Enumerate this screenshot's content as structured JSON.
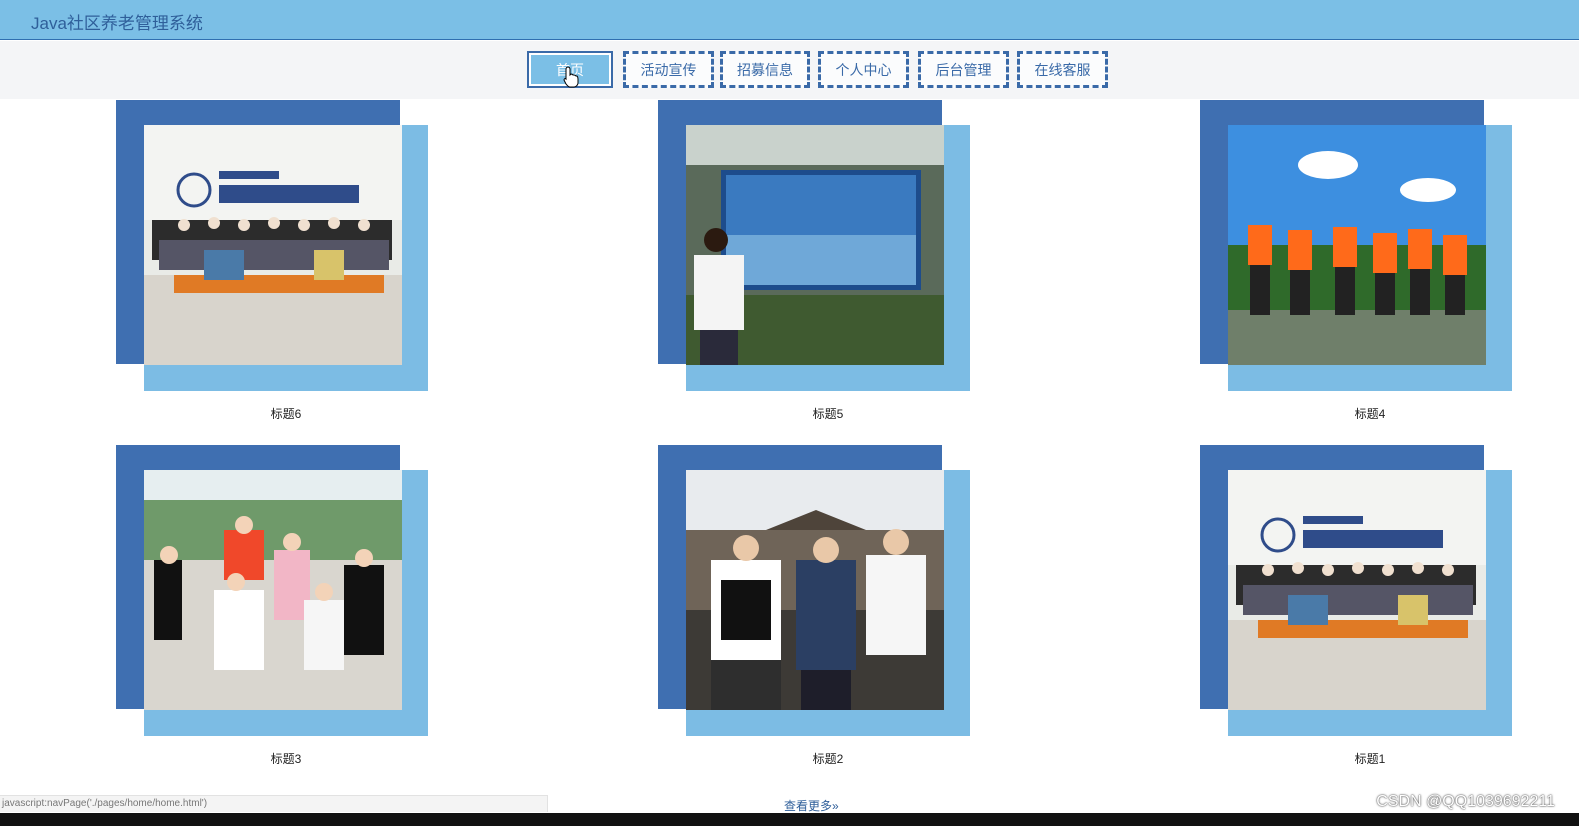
{
  "app": {
    "title": "Java社区养老管理系统"
  },
  "nav": {
    "items": [
      {
        "label": "首页",
        "active": true
      },
      {
        "label": "活动宣传"
      },
      {
        "label": "招募信息"
      },
      {
        "label": "个人中心"
      },
      {
        "label": "后台管理"
      },
      {
        "label": "在线客服"
      }
    ]
  },
  "gallery": {
    "items": [
      {
        "caption": "标题6",
        "photo": "group-photo-institute"
      },
      {
        "caption": "标题5",
        "photo": "person-with-screen"
      },
      {
        "caption": "标题4",
        "photo": "group-life-vests"
      },
      {
        "caption": "标题3",
        "photo": "group-mountain-view"
      },
      {
        "caption": "标题2",
        "photo": "three-students-outdoor"
      },
      {
        "caption": "标题1",
        "photo": "group-photo-institute"
      }
    ]
  },
  "footer": {
    "more_label": "查看更多»",
    "status_url": "javascript:navPage('./pages/home/home.html')",
    "watermark": "CSDN @QQ1039692211"
  },
  "colors": {
    "header_bg": "#7bbfe6",
    "nav_border": "#3a6aa8",
    "frame_dark": "#3f6fb1",
    "frame_light": "#7cbce4"
  }
}
